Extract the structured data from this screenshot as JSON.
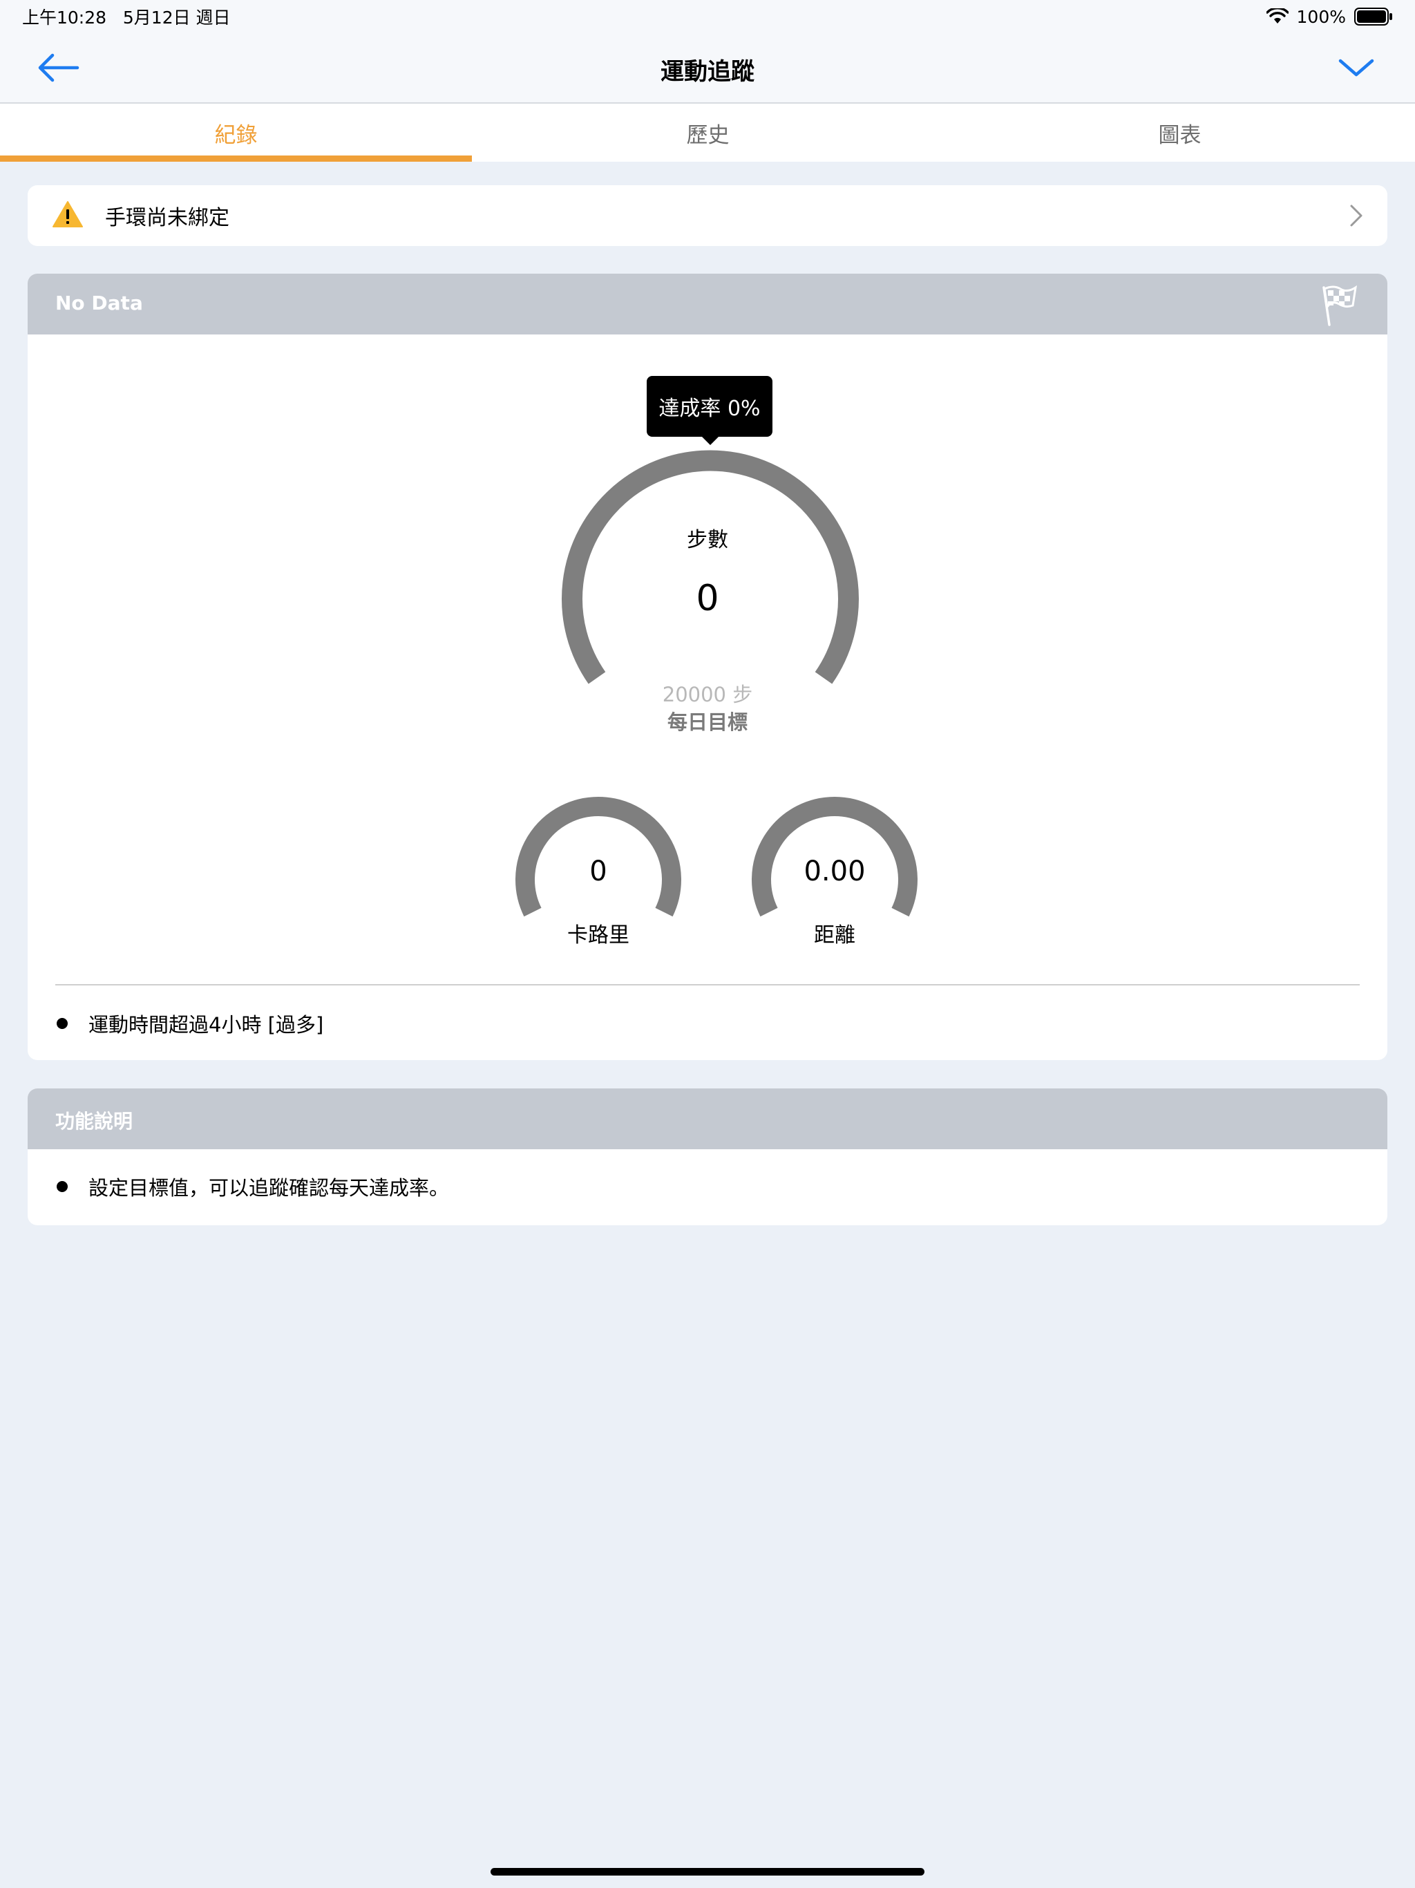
{
  "status_bar": {
    "time": "上午10:28",
    "date": "5月12日 週日",
    "battery": "100%"
  },
  "nav": {
    "title": "運動追蹤"
  },
  "tabs": [
    {
      "label": "紀錄",
      "active": true
    },
    {
      "label": "歷史",
      "active": false
    },
    {
      "label": "圖表",
      "active": false
    }
  ],
  "warning": {
    "text": "手環尚未綁定"
  },
  "record_card": {
    "header": "No Data",
    "tooltip": "達成率 0%",
    "steps": {
      "label": "步數",
      "value": "0",
      "goal": "20000 步",
      "goal_label": "每日目標",
      "progress": 0
    },
    "calories": {
      "value": "0",
      "label": "卡路里"
    },
    "distance": {
      "value": "0.00",
      "label": "距離"
    },
    "notes": [
      "運動時間超過4小時 [過多]"
    ]
  },
  "help_card": {
    "header": "功能說明",
    "items": [
      "設定目標值，可以追蹤確認每天達成率。"
    ]
  },
  "colors": {
    "accent": "#f0a038",
    "nav_blue": "#1e7cf0",
    "gauge_gray": "#7f7f7f",
    "header_gray": "#c4c9d1"
  }
}
